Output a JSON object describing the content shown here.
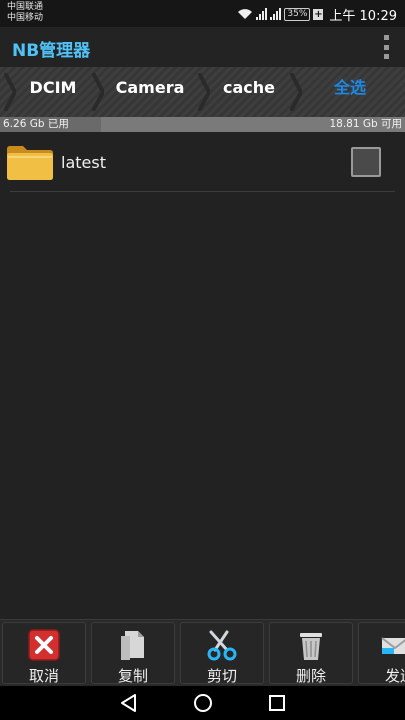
{
  "status_bar": {
    "carrier_1": "中国联通",
    "carrier_2": "中国移动",
    "sig1_tag": "3G",
    "sig2_tag": "2G",
    "battery": "35%",
    "time": "上午 10:29"
  },
  "app_bar": {
    "title": "NB管理器",
    "menu_icon": "overflow-menu-icon"
  },
  "breadcrumb": {
    "items": [
      "DCIM",
      "Camera",
      "cache"
    ],
    "select_all": "全选",
    "accent_color": "#1e88e5"
  },
  "storage": {
    "used": "6.26 Gb 已用",
    "free": "18.81 Gb 可用",
    "used_fraction": 0.25
  },
  "files": [
    {
      "name": "latest",
      "icon": "folder-icon",
      "checked": false
    }
  ],
  "toolbar": {
    "items": [
      {
        "label": "取消",
        "icon": "cancel-icon"
      },
      {
        "label": "复制",
        "icon": "copy-icon"
      },
      {
        "label": "剪切",
        "icon": "scissors-icon"
      },
      {
        "label": "删除",
        "icon": "trash-icon"
      },
      {
        "label": "发送",
        "icon": "send-icon"
      }
    ]
  },
  "nav": {
    "back": "back-icon",
    "home": "home-icon",
    "recents": "recents-icon"
  }
}
